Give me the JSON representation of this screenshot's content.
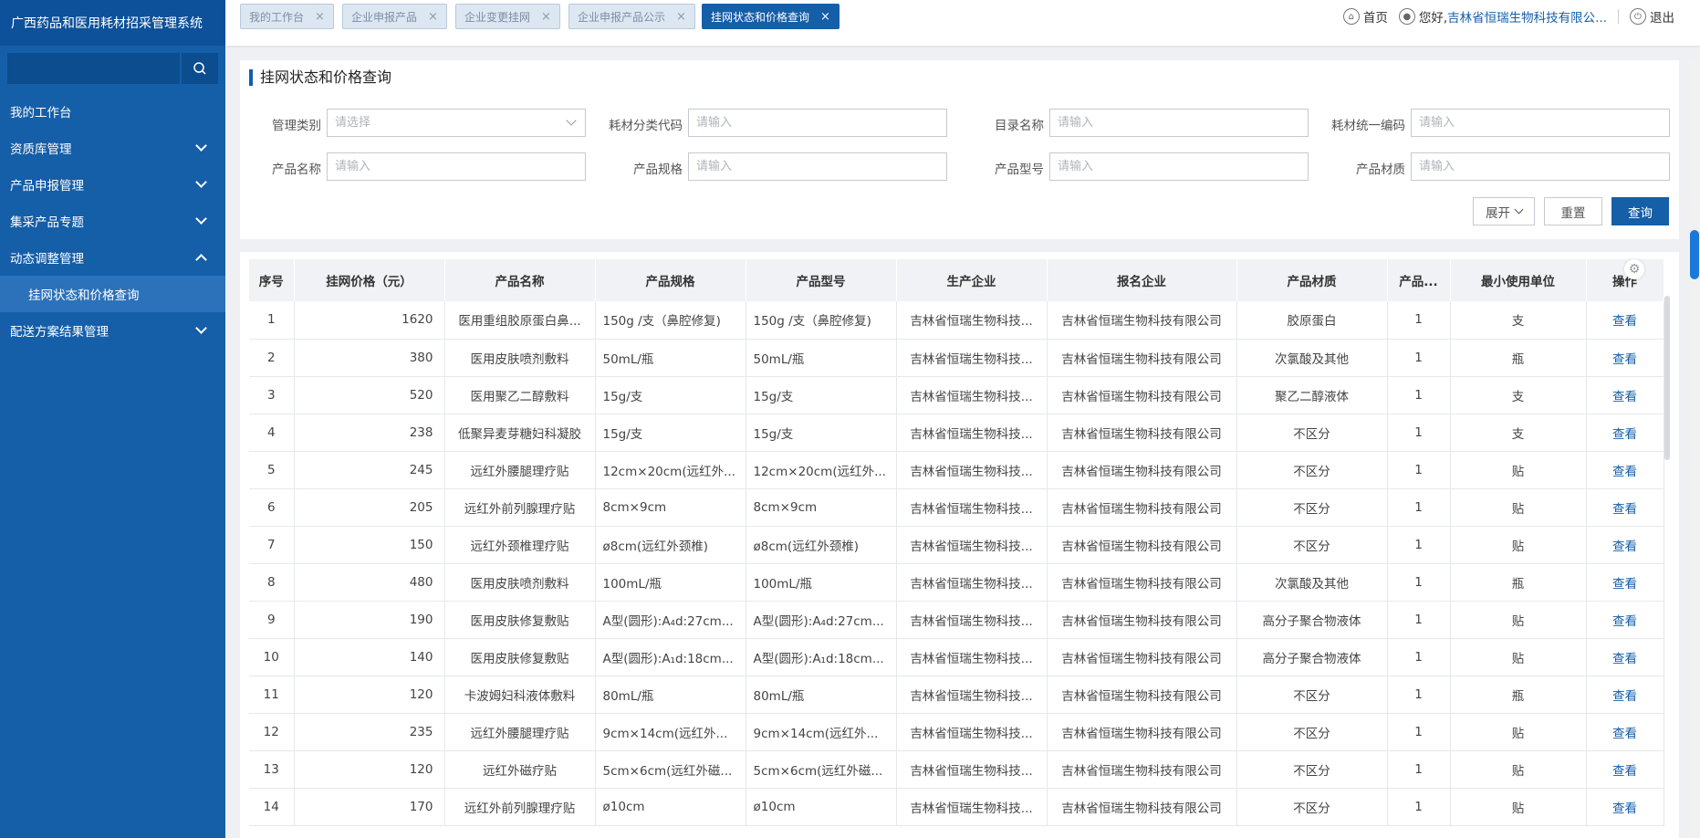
{
  "app_title": "广西药品和医用耗材招采管理系统",
  "sidebar": {
    "items": [
      {
        "label": "我的工作台"
      },
      {
        "label": "资质库管理"
      },
      {
        "label": "产品申报管理"
      },
      {
        "label": "集采产品专题"
      },
      {
        "label": "动态调整管理"
      },
      {
        "label": "挂网状态和价格查询"
      },
      {
        "label": "配送方案结果管理"
      }
    ]
  },
  "tabs": [
    {
      "label": "我的工作台",
      "close": "×"
    },
    {
      "label": "企业申报产品",
      "close": "×"
    },
    {
      "label": "企业变更挂网",
      "close": "×"
    },
    {
      "label": "企业申报产品公示",
      "close": "×"
    },
    {
      "label": "挂网状态和价格查询",
      "close": "×"
    }
  ],
  "topright": {
    "home": "首页",
    "greeting": "您好,",
    "company": "吉林省恒瑞生物科技有限公...",
    "logout": "退出"
  },
  "panel": {
    "title": "挂网状态和价格查询",
    "fields": [
      {
        "label": "管理类别",
        "placeholder": "请选择"
      },
      {
        "label": "耗材分类代码",
        "placeholder": "请输入"
      },
      {
        "label": "目录名称",
        "placeholder": "请输入"
      },
      {
        "label": "耗材统一编码",
        "placeholder": "请输入"
      },
      {
        "label": "产品名称",
        "placeholder": "请输入"
      },
      {
        "label": "产品规格",
        "placeholder": "请输入"
      },
      {
        "label": "产品型号",
        "placeholder": "请输入"
      },
      {
        "label": "产品材质",
        "placeholder": "请输入"
      }
    ],
    "expand": "展开",
    "reset": "重置",
    "query": "查询"
  },
  "table": {
    "headers": [
      "序号",
      "挂网价格（元）",
      "产品名称",
      "产品规格",
      "产品型号",
      "生产企业",
      "报名企业",
      "产品材质",
      "产品...",
      "最小使用单位",
      "操作"
    ],
    "view_label": "查看",
    "rows": [
      [
        "1",
        "1620",
        "医用重组胶原蛋白鼻...",
        "150g /支（鼻腔修复)",
        "150g /支（鼻腔修复)",
        "吉林省恒瑞生物科技...",
        "吉林省恒瑞生物科技有限公司",
        "胶原蛋白",
        "1",
        "支"
      ],
      [
        "2",
        "380",
        "医用皮肤喷剂敷料",
        "50mL/瓶",
        "50mL/瓶",
        "吉林省恒瑞生物科技...",
        "吉林省恒瑞生物科技有限公司",
        "次氯酸及其他",
        "1",
        "瓶"
      ],
      [
        "3",
        "520",
        "医用聚乙二醇敷料",
        "15g/支",
        "15g/支",
        "吉林省恒瑞生物科技...",
        "吉林省恒瑞生物科技有限公司",
        "聚乙二醇液体",
        "1",
        "支"
      ],
      [
        "4",
        "238",
        "低聚异麦芽糖妇科凝胶",
        "15g/支",
        "15g/支",
        "吉林省恒瑞生物科技...",
        "吉林省恒瑞生物科技有限公司",
        "不区分",
        "1",
        "支"
      ],
      [
        "5",
        "245",
        "远红外腰腿理疗贴",
        "12cm×20cm(远红外...",
        "12cm×20cm(远红外...",
        "吉林省恒瑞生物科技...",
        "吉林省恒瑞生物科技有限公司",
        "不区分",
        "1",
        "贴"
      ],
      [
        "6",
        "205",
        "远红外前列腺理疗贴",
        "8cm×9cm",
        "8cm×9cm",
        "吉林省恒瑞生物科技...",
        "吉林省恒瑞生物科技有限公司",
        "不区分",
        "1",
        "贴"
      ],
      [
        "7",
        "150",
        "远红外颈椎理疗贴",
        "ø8cm(远红外颈椎)",
        "ø8cm(远红外颈椎)",
        "吉林省恒瑞生物科技...",
        "吉林省恒瑞生物科技有限公司",
        "不区分",
        "1",
        "贴"
      ],
      [
        "8",
        "480",
        "医用皮肤喷剂敷料",
        "100mL/瓶",
        "100mL/瓶",
        "吉林省恒瑞生物科技...",
        "吉林省恒瑞生物科技有限公司",
        "次氯酸及其他",
        "1",
        "瓶"
      ],
      [
        "9",
        "190",
        "医用皮肤修复敷贴",
        "A型(圆形):A₄d:27cm...",
        "A型(圆形):A₄d:27cm...",
        "吉林省恒瑞生物科技...",
        "吉林省恒瑞生物科技有限公司",
        "高分子聚合物液体",
        "1",
        "贴"
      ],
      [
        "10",
        "140",
        "医用皮肤修复敷贴",
        "A型(圆形):A₁d:18cm...",
        "A型(圆形):A₁d:18cm...",
        "吉林省恒瑞生物科技...",
        "吉林省恒瑞生物科技有限公司",
        "高分子聚合物液体",
        "1",
        "贴"
      ],
      [
        "11",
        "120",
        "卡波姆妇科液体敷料",
        "80mL/瓶",
        "80mL/瓶",
        "吉林省恒瑞生物科技...",
        "吉林省恒瑞生物科技有限公司",
        "不区分",
        "1",
        "瓶"
      ],
      [
        "12",
        "235",
        "远红外腰腿理疗贴",
        "9cm×14cm(远红外...",
        "9cm×14cm(远红外...",
        "吉林省恒瑞生物科技...",
        "吉林省恒瑞生物科技有限公司",
        "不区分",
        "1",
        "贴"
      ],
      [
        "13",
        "120",
        "远红外磁疗贴",
        "5cm×6cm(远红外磁...",
        "5cm×6cm(远红外磁...",
        "吉林省恒瑞生物科技...",
        "吉林省恒瑞生物科技有限公司",
        "不区分",
        "1",
        "贴"
      ],
      [
        "14",
        "170",
        "远红外前列腺理疗贴",
        "ø10cm",
        "ø10cm",
        "吉林省恒瑞生物科技...",
        "吉林省恒瑞生物科技有限公司",
        "不区分",
        "1",
        "贴"
      ]
    ]
  },
  "colors": {
    "primary": "#155ea8",
    "sidebar": "#155ea8",
    "sidebar_active": "#2c72ba"
  }
}
